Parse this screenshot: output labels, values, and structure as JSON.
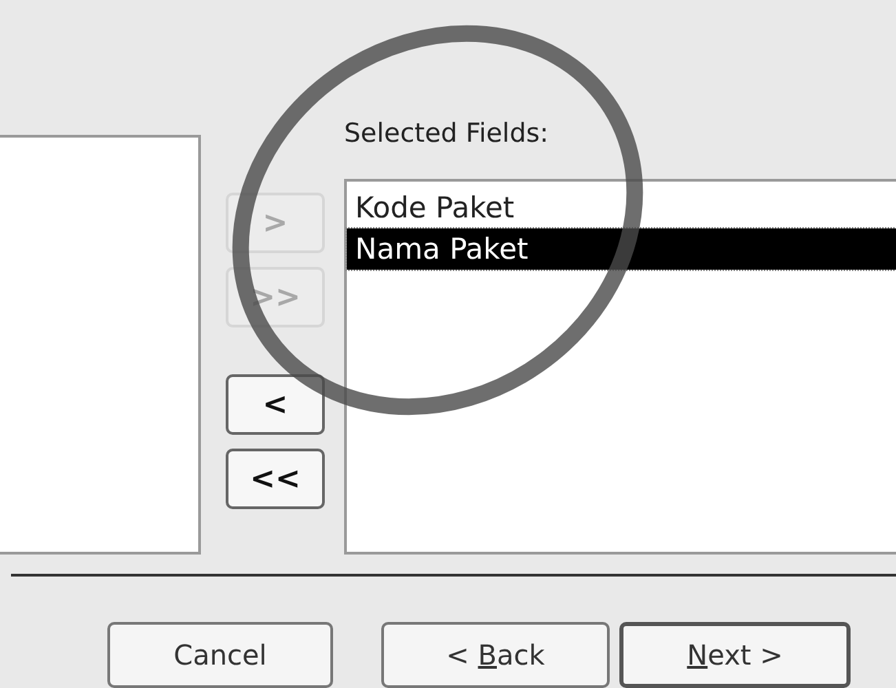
{
  "move_buttons": [
    {
      "label": ">",
      "disabled": true
    },
    {
      "label": ">>",
      "disabled": true
    },
    {
      "label": "<",
      "disabled": false
    },
    {
      "label": "<<",
      "disabled": false
    }
  ],
  "selected_fields": {
    "label": "Selected Fields:",
    "items": [
      {
        "label": "Kode Paket",
        "selected": false
      },
      {
        "label": "Nama Paket",
        "selected": true
      }
    ]
  },
  "footer_buttons": [
    {
      "parts": [
        {
          "text": "Cancel",
          "underlined": false
        }
      ],
      "default": false
    },
    {
      "parts": [
        {
          "text": "< ",
          "underlined": false
        },
        {
          "text": "B",
          "underlined": true
        },
        {
          "text": "ack",
          "underlined": false
        }
      ],
      "default": false
    },
    {
      "parts": [
        {
          "text": "N",
          "underlined": true
        },
        {
          "text": "ext >",
          "underlined": false
        }
      ],
      "default": true
    }
  ]
}
